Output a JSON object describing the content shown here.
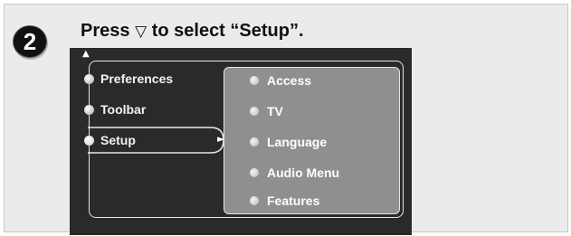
{
  "step": {
    "number": "2"
  },
  "instruction": {
    "prefix": "Press",
    "key_symbol": "▽",
    "suffix": "to select “Setup”."
  },
  "screen": {
    "scroll_indicator": "▲",
    "main_menu": [
      {
        "label": "Preferences",
        "selected": false
      },
      {
        "label": "Toolbar",
        "selected": false
      },
      {
        "label": "Setup",
        "selected": true
      }
    ],
    "selection_arrow": "►",
    "submenu": [
      {
        "label": "Access"
      },
      {
        "label": "TV"
      },
      {
        "label": "Language"
      },
      {
        "label": "Audio Menu"
      },
      {
        "label": "Features"
      }
    ]
  },
  "colors": {
    "panel_background": "#ebebeb",
    "screen_background": "#2a2a2a",
    "submenu_background": "#8f8f8f",
    "badge_fill": "#111111"
  },
  "icons": {
    "step_badge": "numbered-circle-icon",
    "down_key": "down-triangle-key-icon",
    "scroll_up": "up-arrow-icon",
    "selection": "right-pointer-icon",
    "menu_bullet": "round-bullet-icon"
  }
}
